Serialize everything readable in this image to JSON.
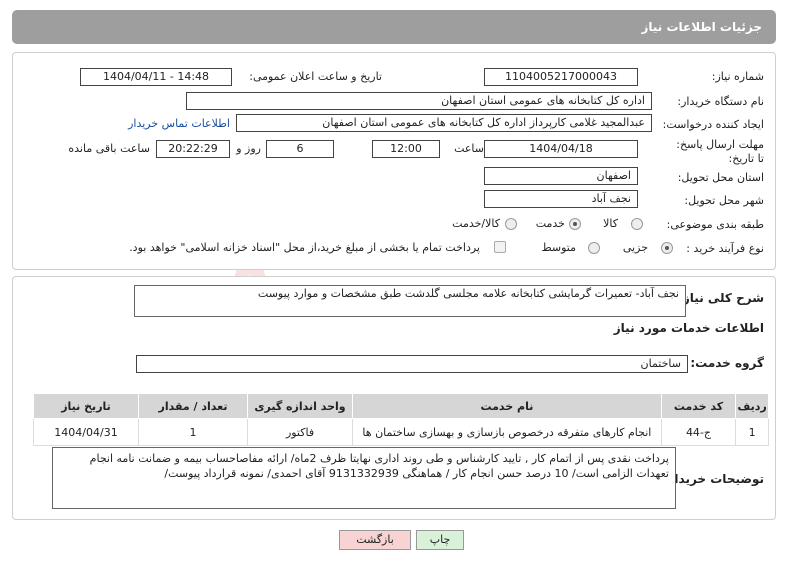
{
  "header": {
    "title": "جزئیات اطلاعات نیاز"
  },
  "form": {
    "need_number_label": "شماره نیاز:",
    "need_number": "1104005217000043",
    "announce_label": "تاریخ و ساعت اعلان عمومی:",
    "announce_value": "1404/04/11 - 14:48",
    "buyer_org_label": "نام دستگاه خریدار:",
    "buyer_org": "اداره کل کتابخانه های عمومی استان اصفهان",
    "creator_label": "ایجاد کننده درخواست:",
    "creator": "عبدالمجید غلامی کارپرداز اداره کل کتابخانه های عمومی استان اصفهان",
    "contact_link": "اطلاعات تماس خریدار",
    "deadline_label": "مهلت ارسال پاسخ: تا تاریخ:",
    "deadline_date": "1404/04/18",
    "time_label": "ساعت",
    "deadline_time": "12:00",
    "days_value": "6",
    "days_label": "روز و",
    "remaining_time": "20:22:29",
    "remaining_label": "ساعت باقی مانده",
    "province_label": "استان محل تحویل:",
    "province": "اصفهان",
    "city_label": "شهر محل تحویل:",
    "city": "نجف آباد",
    "category_label": "طبقه بندی موضوعی:",
    "category_options": [
      "کالا",
      "خدمت",
      "کالا/خدمت"
    ],
    "category_selected": "خدمت",
    "process_label": "نوع فرآیند خرید :",
    "process_options": [
      "جزیی",
      "متوسط"
    ],
    "process_selected": "جزیی",
    "payment_note": "پرداخت تمام یا بخشی از مبلغ خرید،از محل \"اسناد خزانه اسلامی\" خواهد بود."
  },
  "summary": {
    "label": "شرح کلی نیاز:",
    "text": "نجف آباد- تعمیرات گرمایشی کتابخانه علامه مجلسی گلدشت طبق مشخصات و موارد پیوست"
  },
  "services": {
    "section_title": "اطلاعات خدمات مورد نیاز",
    "group_label": "گروه خدمت:",
    "group_value": "ساختمان",
    "columns": [
      "ردیف",
      "کد خدمت",
      "نام خدمت",
      "واحد اندازه گیری",
      "تعداد / مقدار",
      "تاریخ نیاز"
    ],
    "rows": [
      [
        "1",
        "ج-44",
        "انجام کارهای متفرقه درخصوص بازسازی و بهسازی ساختمان ها",
        "فاکتور",
        "1",
        "1404/04/31"
      ]
    ]
  },
  "notes": {
    "label": "توضیحات خریدار:",
    "text": "پرداخت نقدی پس از اتمام کار , تایید کارشناس و طی روند اداری نهایتا ظرف 2ماه/ ارائه مفاصاحساب بیمه و ضمانت نامه انجام تعهدات الزامی است/ 10 درصد حسن انجام کار /  هماهنگی 9131332939 آقای احمدی/ نمونه قرارداد پیوست/"
  },
  "buttons": {
    "print": "چاپ",
    "back": "بازگشت"
  },
  "colors": {
    "header_bg": "#9e9e9e",
    "back_btn": "#f7d3d3",
    "print_btn": "#d9f0d9",
    "link": "#1a4fa0"
  }
}
